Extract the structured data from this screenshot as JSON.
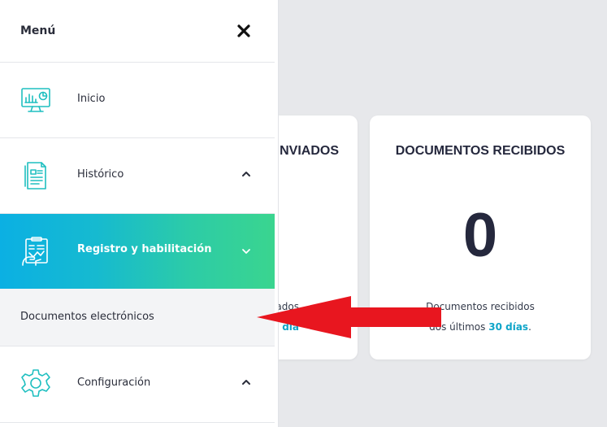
{
  "sidebar": {
    "title": "Menú",
    "items": [
      {
        "label": "Inicio",
        "icon": "dashboard-monitor-icon"
      },
      {
        "label": "Histórico",
        "icon": "document-list-icon",
        "chevron": "chevron-up-icon"
      },
      {
        "label": "Registro y habilitación",
        "icon": "clipboard-hand-icon",
        "chevron": "chevron-down-icon",
        "active": true
      },
      {
        "label": "Configuración",
        "icon": "gear-icon",
        "chevron": "chevron-up-icon"
      }
    ],
    "subitems": [
      {
        "label": "Documentos electrónicos"
      }
    ]
  },
  "cards": {
    "sent": {
      "title": "NVIADOS",
      "desc_line1": "ados",
      "desc_highlight": "día"
    },
    "received": {
      "title": "DOCUMENTOS RECIBIDOS",
      "count": "0",
      "desc_line1": "Documentos recibidos",
      "desc_line2_prefix": "dos últimos",
      "desc_highlight": "30 días",
      "desc_suffix": "."
    }
  },
  "colors": {
    "accent_teal": "#1fbfc0",
    "active_gradient_start": "#0bb0e3",
    "active_gradient_end": "#3ad58f",
    "highlight_text": "#0fa5c9",
    "annotation_arrow": "#e8161f"
  }
}
